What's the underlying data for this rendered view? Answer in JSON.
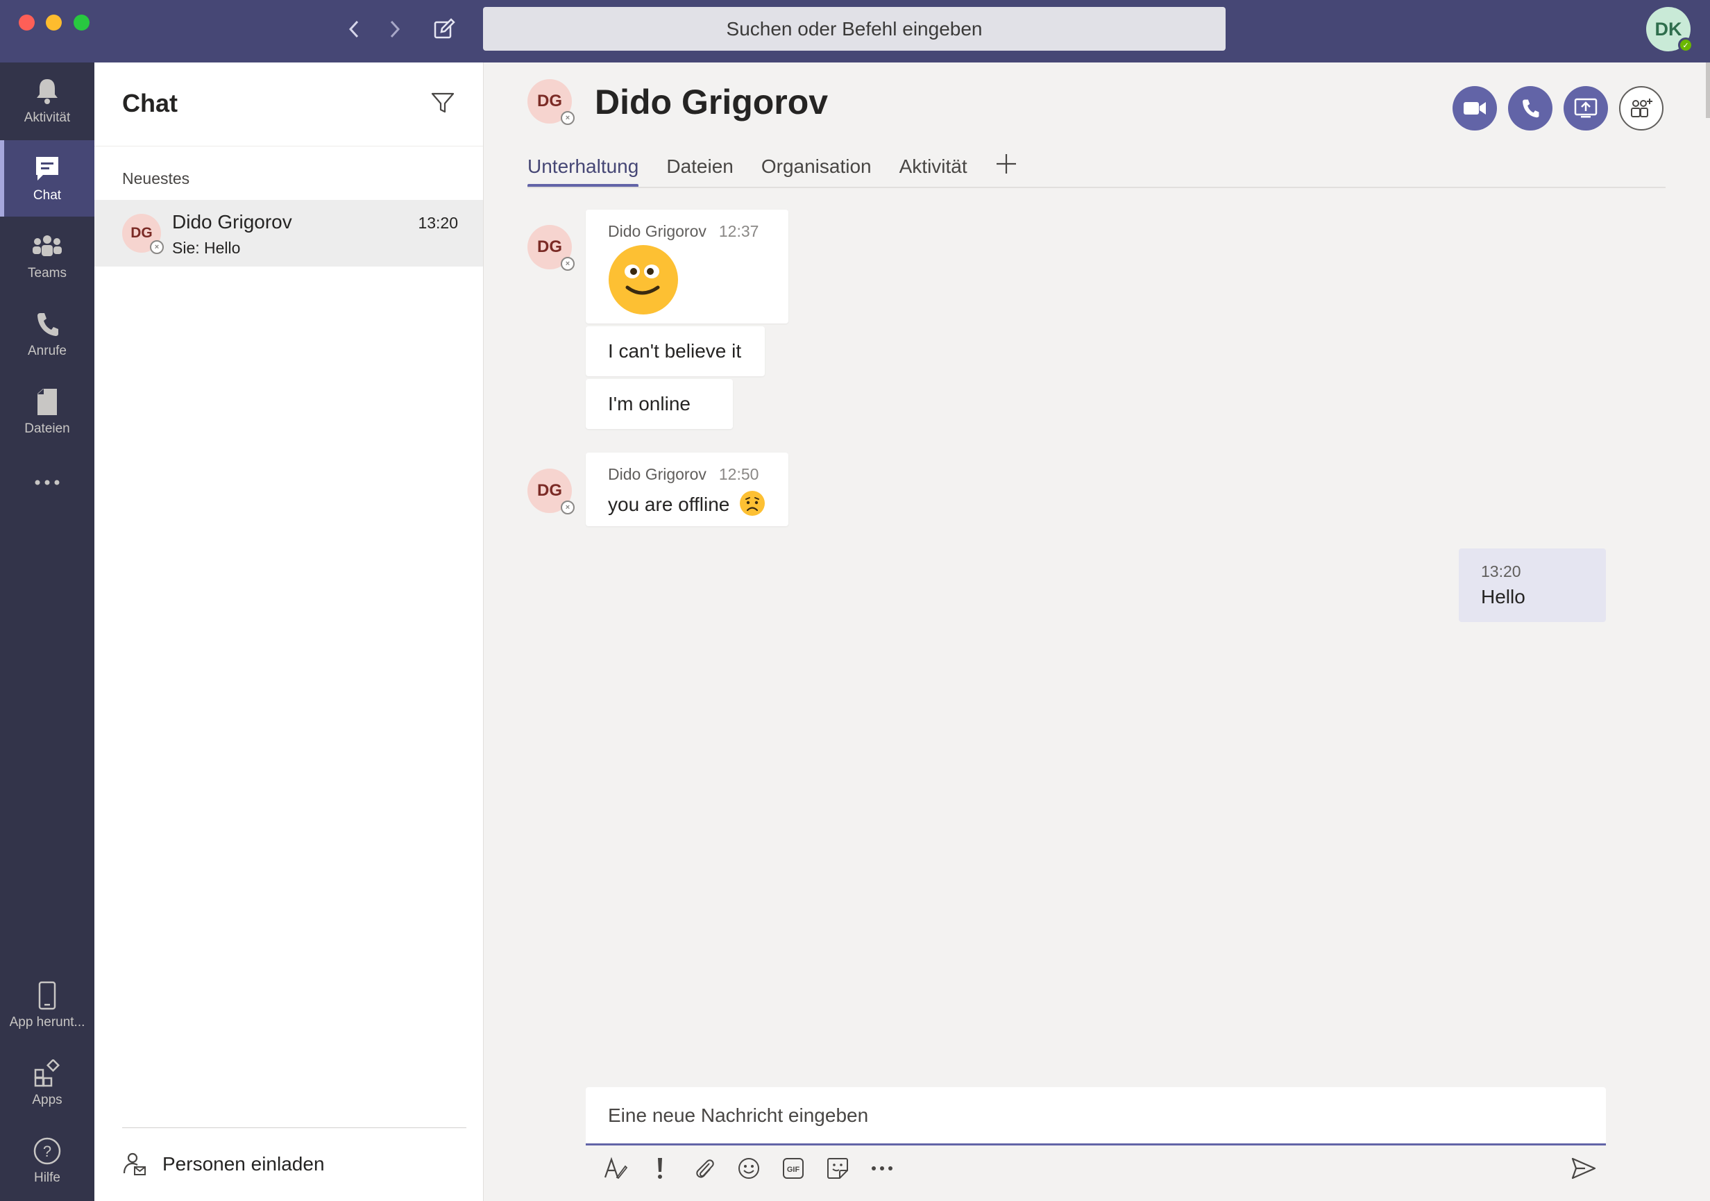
{
  "window": {
    "traffic_lights": [
      "close",
      "minimize",
      "zoom"
    ],
    "search_placeholder": "Suchen oder Befehl eingeben",
    "user_initials": "DK",
    "user_status": "available"
  },
  "rail": {
    "items": [
      {
        "label": "Aktivität",
        "icon": "bell-icon"
      },
      {
        "label": "Chat",
        "icon": "chat-icon",
        "active": true
      },
      {
        "label": "Teams",
        "icon": "teams-icon"
      },
      {
        "label": "Anrufe",
        "icon": "phone-icon"
      },
      {
        "label": "Dateien",
        "icon": "file-icon"
      }
    ],
    "more_icon": "more-icon",
    "bottom_items": [
      {
        "label": "App herunt...",
        "icon": "mobile-icon"
      },
      {
        "label": "Apps",
        "icon": "apps-icon"
      },
      {
        "label": "Hilfe",
        "icon": "help-icon"
      }
    ]
  },
  "chatlist": {
    "title": "Chat",
    "section": "Neuestes",
    "items": [
      {
        "initials": "DG",
        "name": "Dido Grigorov",
        "time": "13:20",
        "preview": "Sie: Hello",
        "status": "offline"
      }
    ],
    "invite_label": "Personen einladen"
  },
  "conversation": {
    "initials": "DG",
    "name": "Dido Grigorov",
    "tabs": [
      "Unterhaltung",
      "Dateien",
      "Organisation",
      "Aktivität"
    ],
    "active_tab": "Unterhaltung",
    "header_buttons": [
      "video-call-icon",
      "audio-call-icon",
      "share-screen-icon",
      "add-people-icon"
    ],
    "messages": [
      {
        "sender": "Dido Grigorov",
        "time": "12:37",
        "content": "smiley-emoji",
        "initials": "DG"
      },
      {
        "text": "I can't believe it"
      },
      {
        "text": "I'm online"
      },
      {
        "sender": "Dido Grigorov",
        "time": "12:50",
        "text": "you are offline",
        "emoji": "sad-emoji",
        "initials": "DG"
      }
    ],
    "my_message": {
      "time": "13:20",
      "text": "Hello"
    },
    "compose_placeholder": "Eine neue Nachricht eingeben",
    "compose_tools": [
      "format-icon",
      "important-icon",
      "attach-icon",
      "emoji-icon",
      "gif-icon",
      "sticker-icon",
      "more-options-icon"
    ]
  },
  "colors": {
    "brand": "#6264a7",
    "titlebar": "#464775",
    "rail": "#33344a",
    "avatar_bg": "#f6d4cf"
  }
}
